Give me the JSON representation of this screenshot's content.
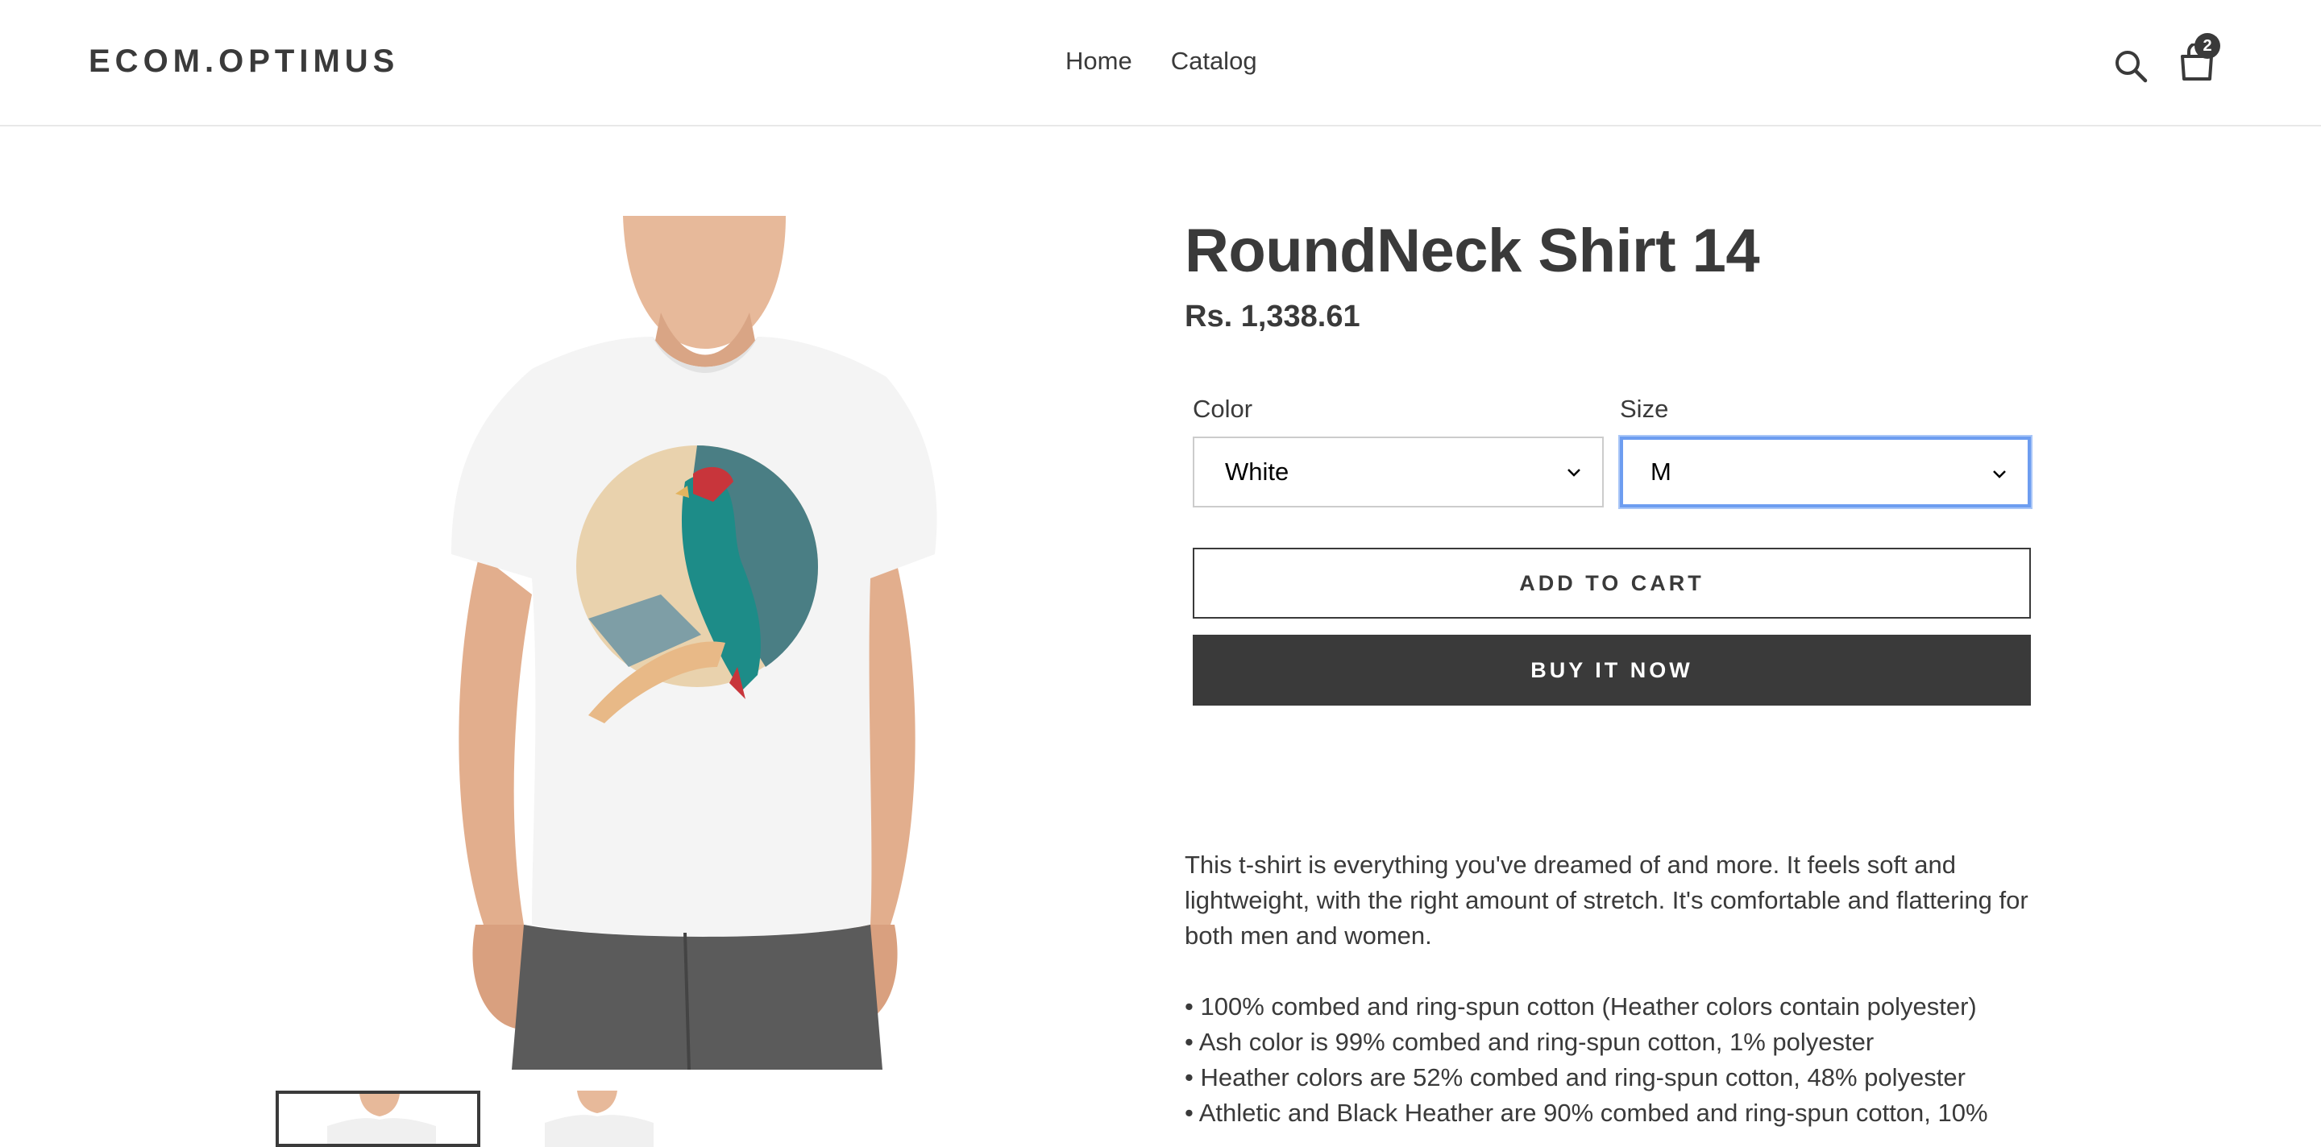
{
  "header": {
    "logo": "ECOM.OPTIMUS",
    "nav": [
      "Home",
      "Catalog"
    ],
    "cart_count": "2",
    "icons": [
      "search-icon",
      "cart-icon"
    ]
  },
  "product": {
    "title": "RoundNeck Shirt 14",
    "price": "Rs. 1,338.61",
    "color_label": "Color",
    "color_value": "White",
    "size_label": "Size",
    "size_value": "M",
    "add_to_cart": "ADD TO CART",
    "buy_now": "BUY IT NOW",
    "description": "This t-shirt is everything you've dreamed of and more. It feels soft and lightweight, with the right amount of stretch. It's comfortable and flattering for both men and women.",
    "bullets": [
      "• 100% combed and ring-spun cotton (Heather colors contain polyester)",
      "• Ash color is 99% combed and ring-spun cotton, 1% polyester",
      "• Heather colors are 52% combed and ring-spun cotton, 48% polyester",
      "• Athletic and Black Heather are 90% combed and ring-spun cotton, 10%"
    ]
  },
  "colors": {
    "text": "#3a3a3a",
    "button_dark": "#3a3a3a",
    "focus_ring": "#6d9df0"
  }
}
